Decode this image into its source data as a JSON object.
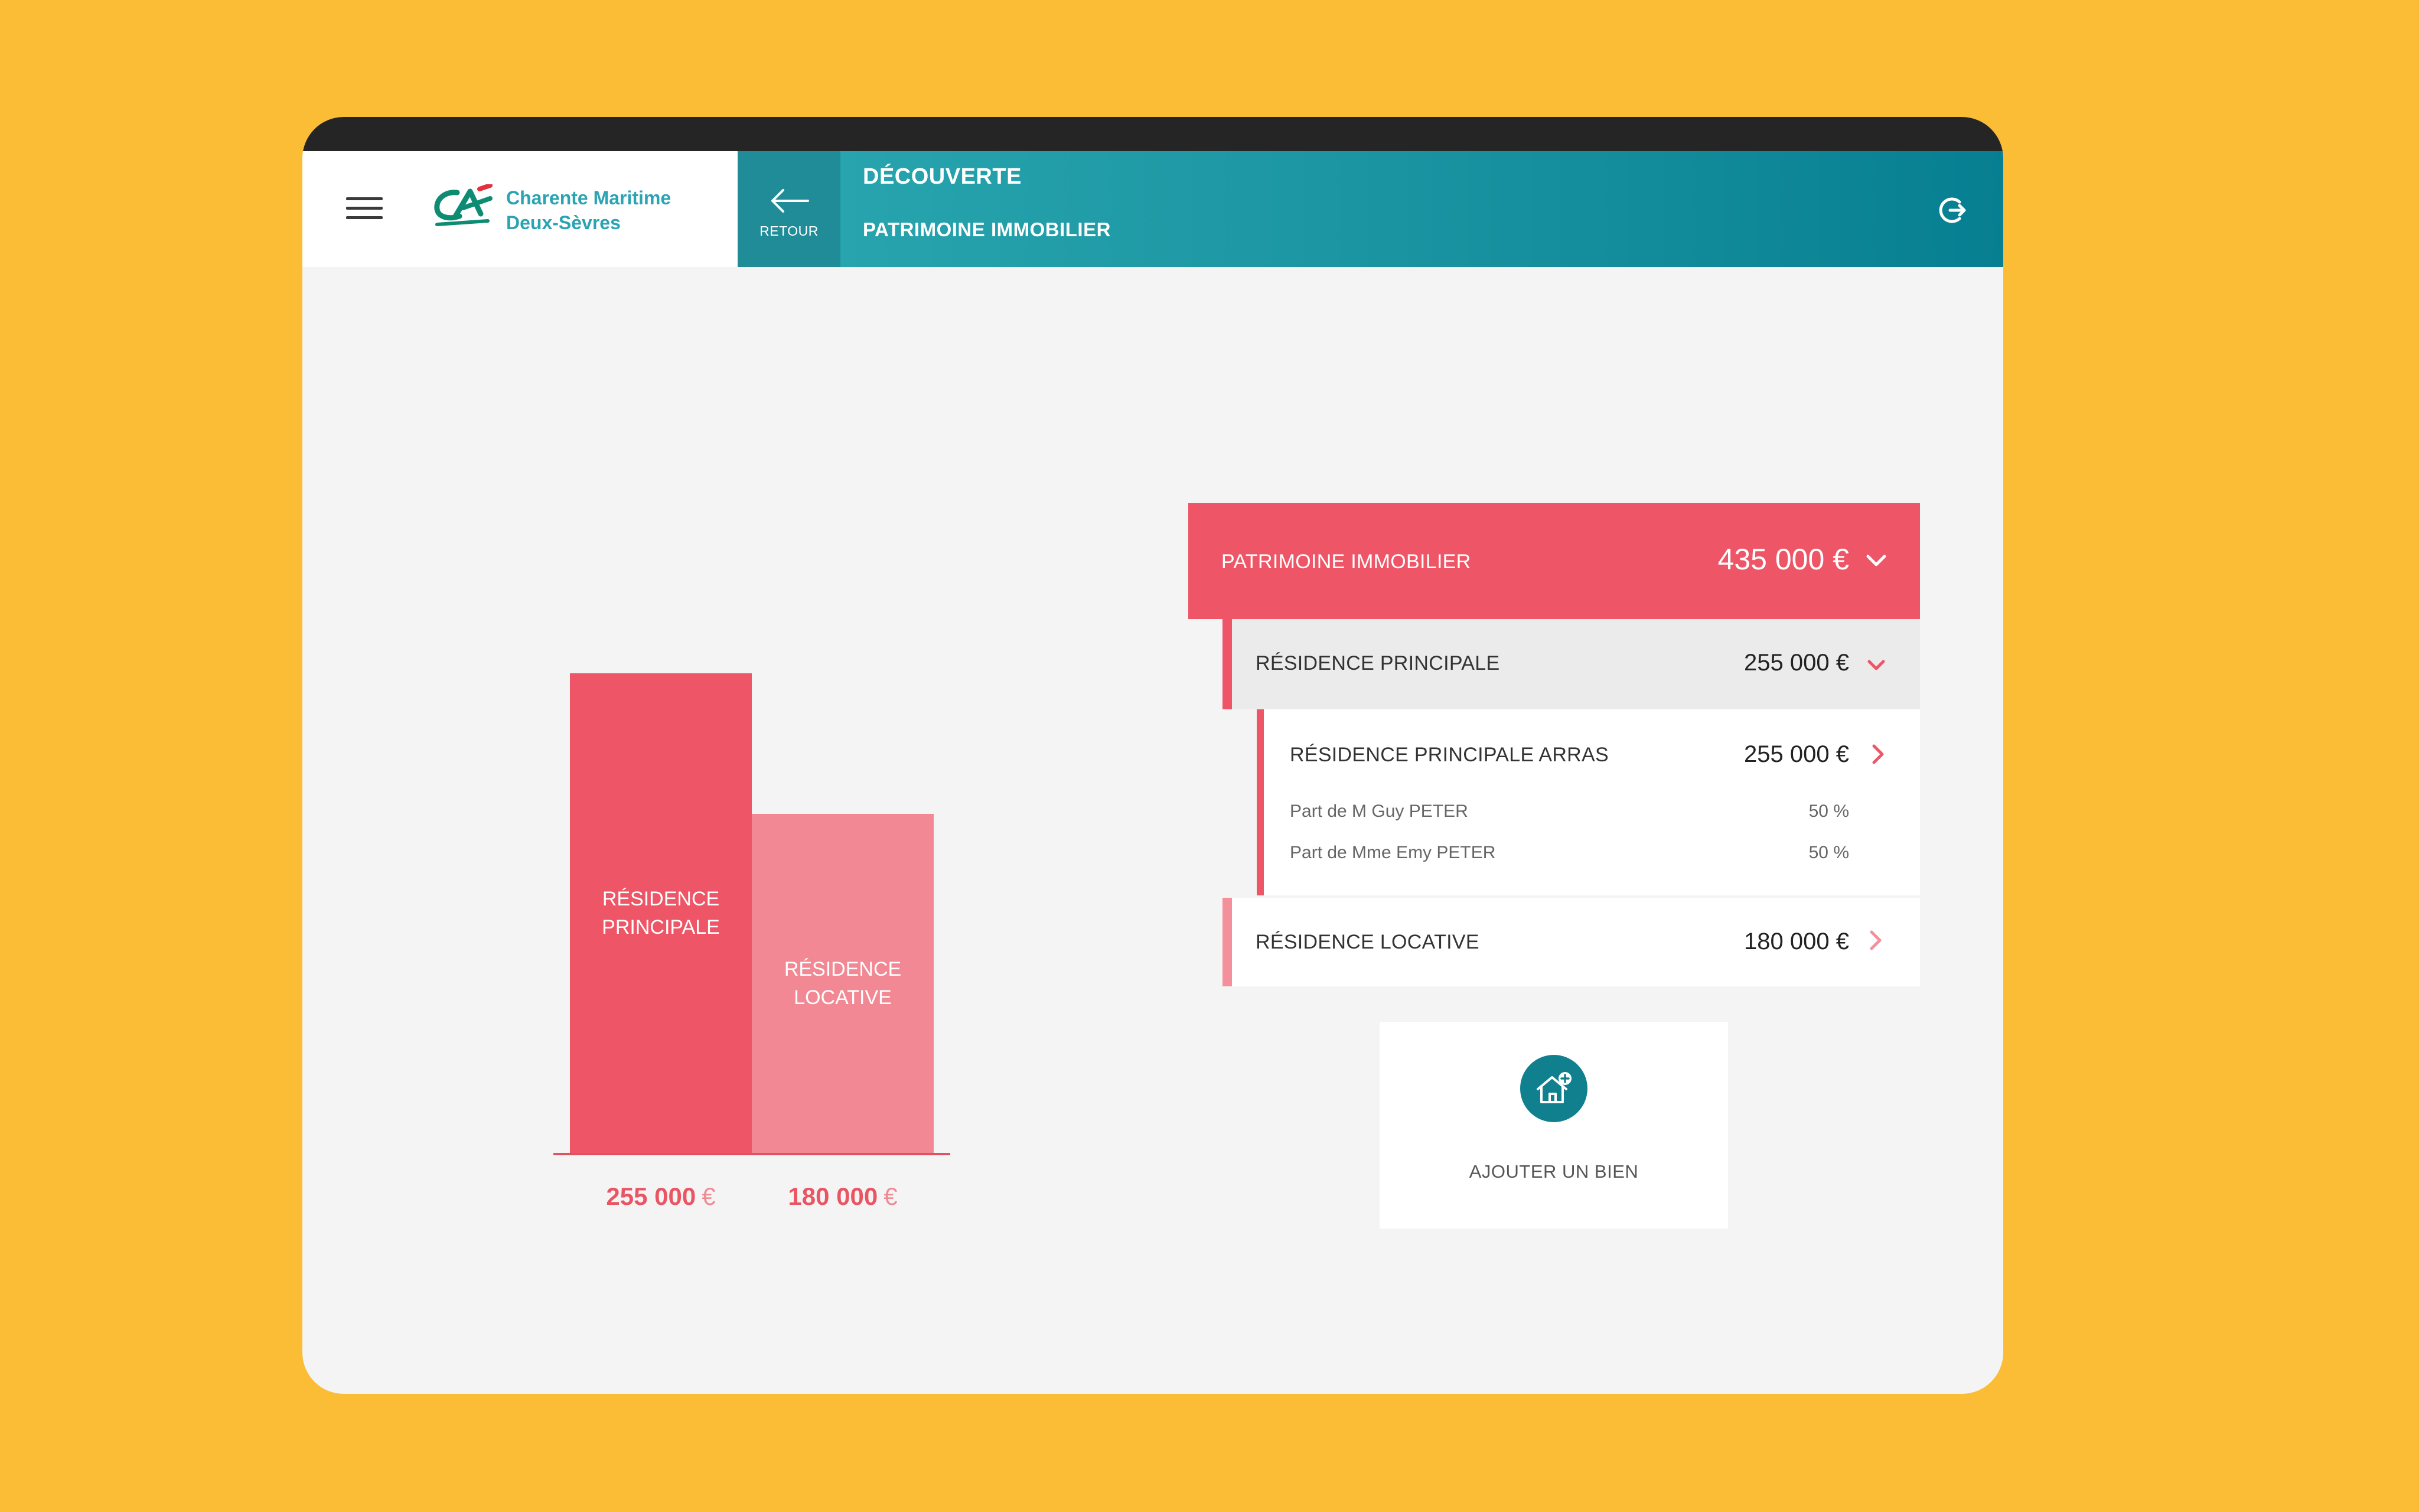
{
  "app": {
    "brand_line1": "Charente Maritime",
    "brand_line2": "Deux-Sèvres",
    "back_label": "RETOUR",
    "title": "DÉCOUVERTE",
    "subtitle": "PATRIMOINE IMMOBILIER"
  },
  "colors": {
    "accent_red": "#EE5566",
    "accent_pink": "#F4909B",
    "teal": "#1F8C98",
    "background": "#FBBD35"
  },
  "chart_data": {
    "type": "bar",
    "categories": [
      "RÉSIDENCE\nPRINCIPALE",
      "RÉSIDENCE\nLOCATIVE"
    ],
    "values": [
      255000,
      180000
    ],
    "value_labels": [
      {
        "amount": "255 000",
        "currency": "€"
      },
      {
        "amount": "180 000",
        "currency": "€"
      }
    ],
    "colors": [
      "#EE5566",
      "#F28893"
    ],
    "ylim": [
      0,
      290000
    ],
    "grid": false,
    "title": "",
    "xlabel": "",
    "ylabel": ""
  },
  "patrimoine": {
    "label": "PATRIMOINE IMMOBILIER",
    "amount": "435 000 €",
    "residence_principale": {
      "label": "RÉSIDENCE PRINCIPALE",
      "amount": "255 000 €",
      "item": {
        "label": "RÉSIDENCE PRINCIPALE ARRAS",
        "amount": "255 000 €",
        "owners": [
          {
            "name": "Part de M Guy PETER",
            "share": "50 %"
          },
          {
            "name": "Part de Mme Emy PETER",
            "share": "50 %"
          }
        ]
      }
    },
    "residence_locative": {
      "label": "RÉSIDENCE LOCATIVE",
      "amount": "180 000 €"
    }
  },
  "add_button": {
    "label": "AJOUTER UN BIEN",
    "icon": "house-plus-icon"
  }
}
